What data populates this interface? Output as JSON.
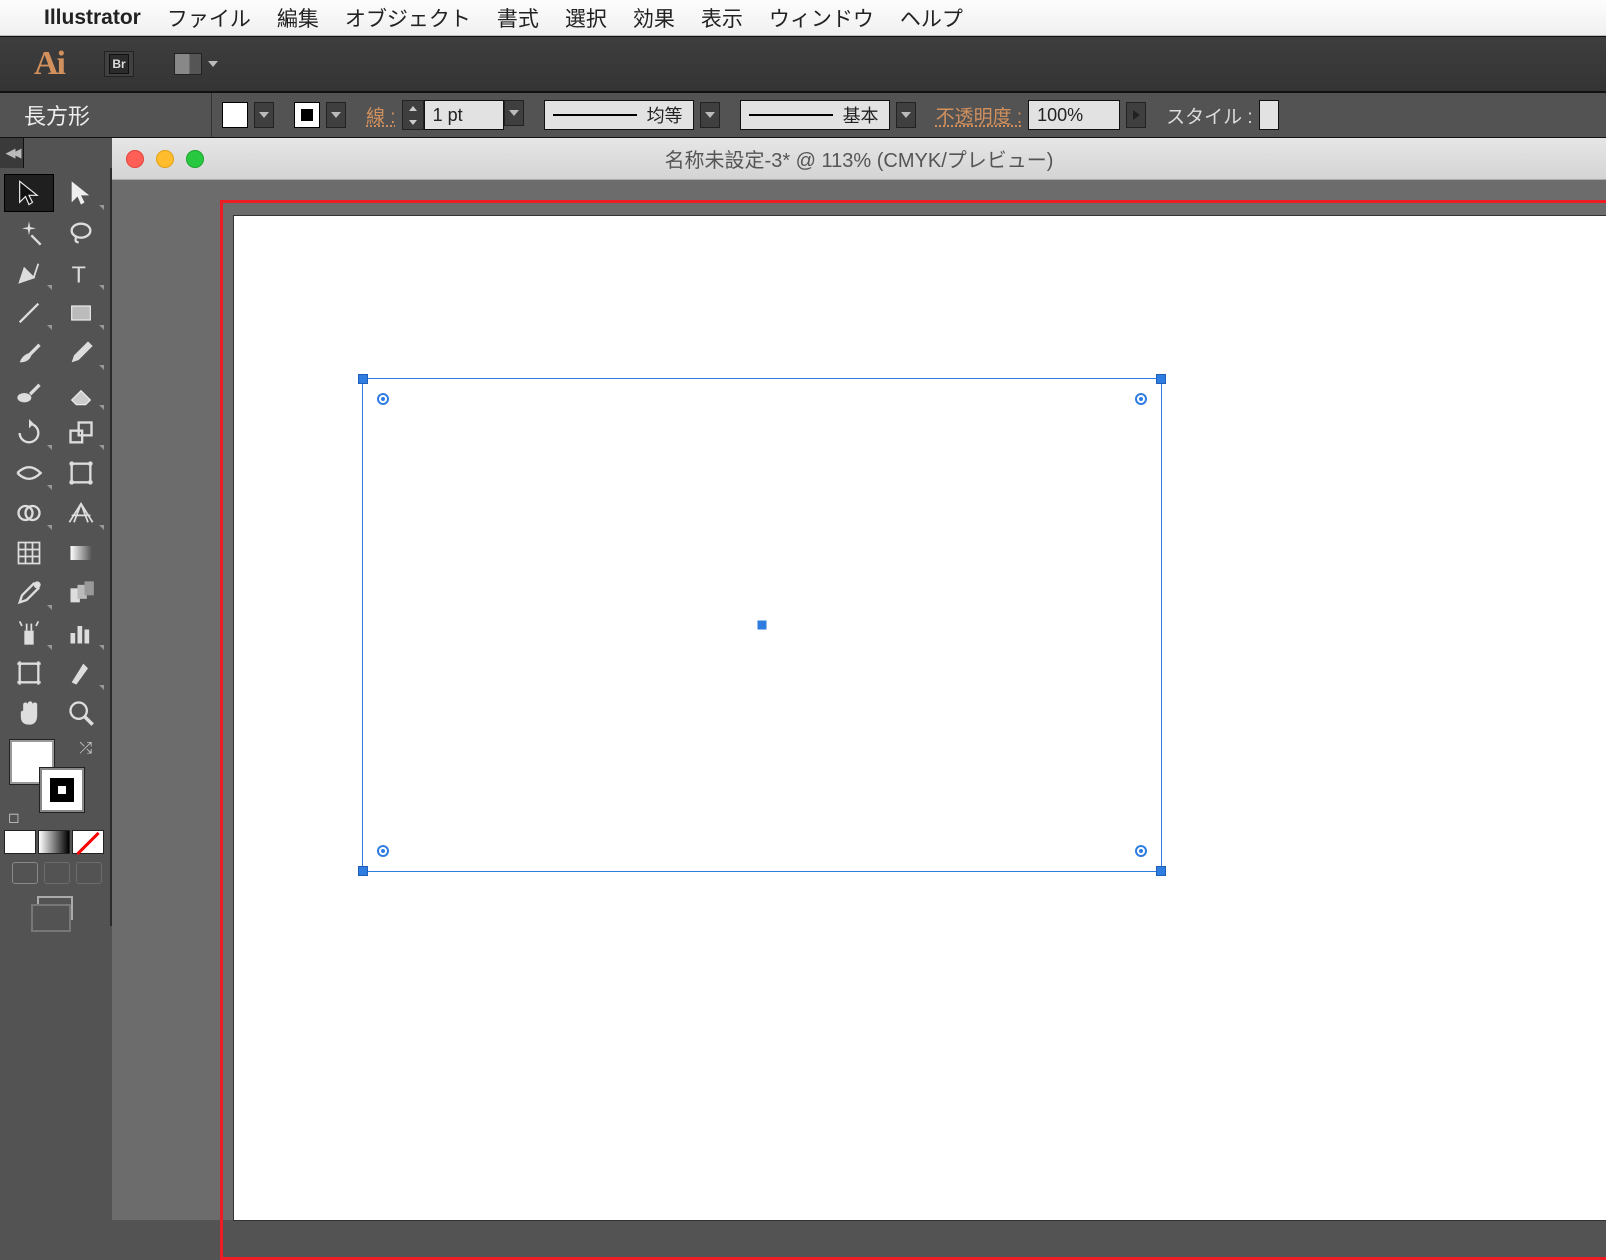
{
  "menubar": {
    "app": "Illustrator",
    "items": [
      "ファイル",
      "編集",
      "オブジェクト",
      "書式",
      "選択",
      "効果",
      "表示",
      "ウィンドウ",
      "ヘルプ"
    ]
  },
  "topbar": {
    "ai": "Ai",
    "br": "Br"
  },
  "control": {
    "shape": "長方形",
    "stroke_label": "線 :",
    "stroke_weight": "1 pt",
    "profile": "均等",
    "brush": "基本",
    "opacity_label": "不透明度 :",
    "opacity_value": "100%",
    "style_label": "スタイル :"
  },
  "document": {
    "title": "名称未設定-3* @ 113% (CMYK/プレビュー)"
  }
}
